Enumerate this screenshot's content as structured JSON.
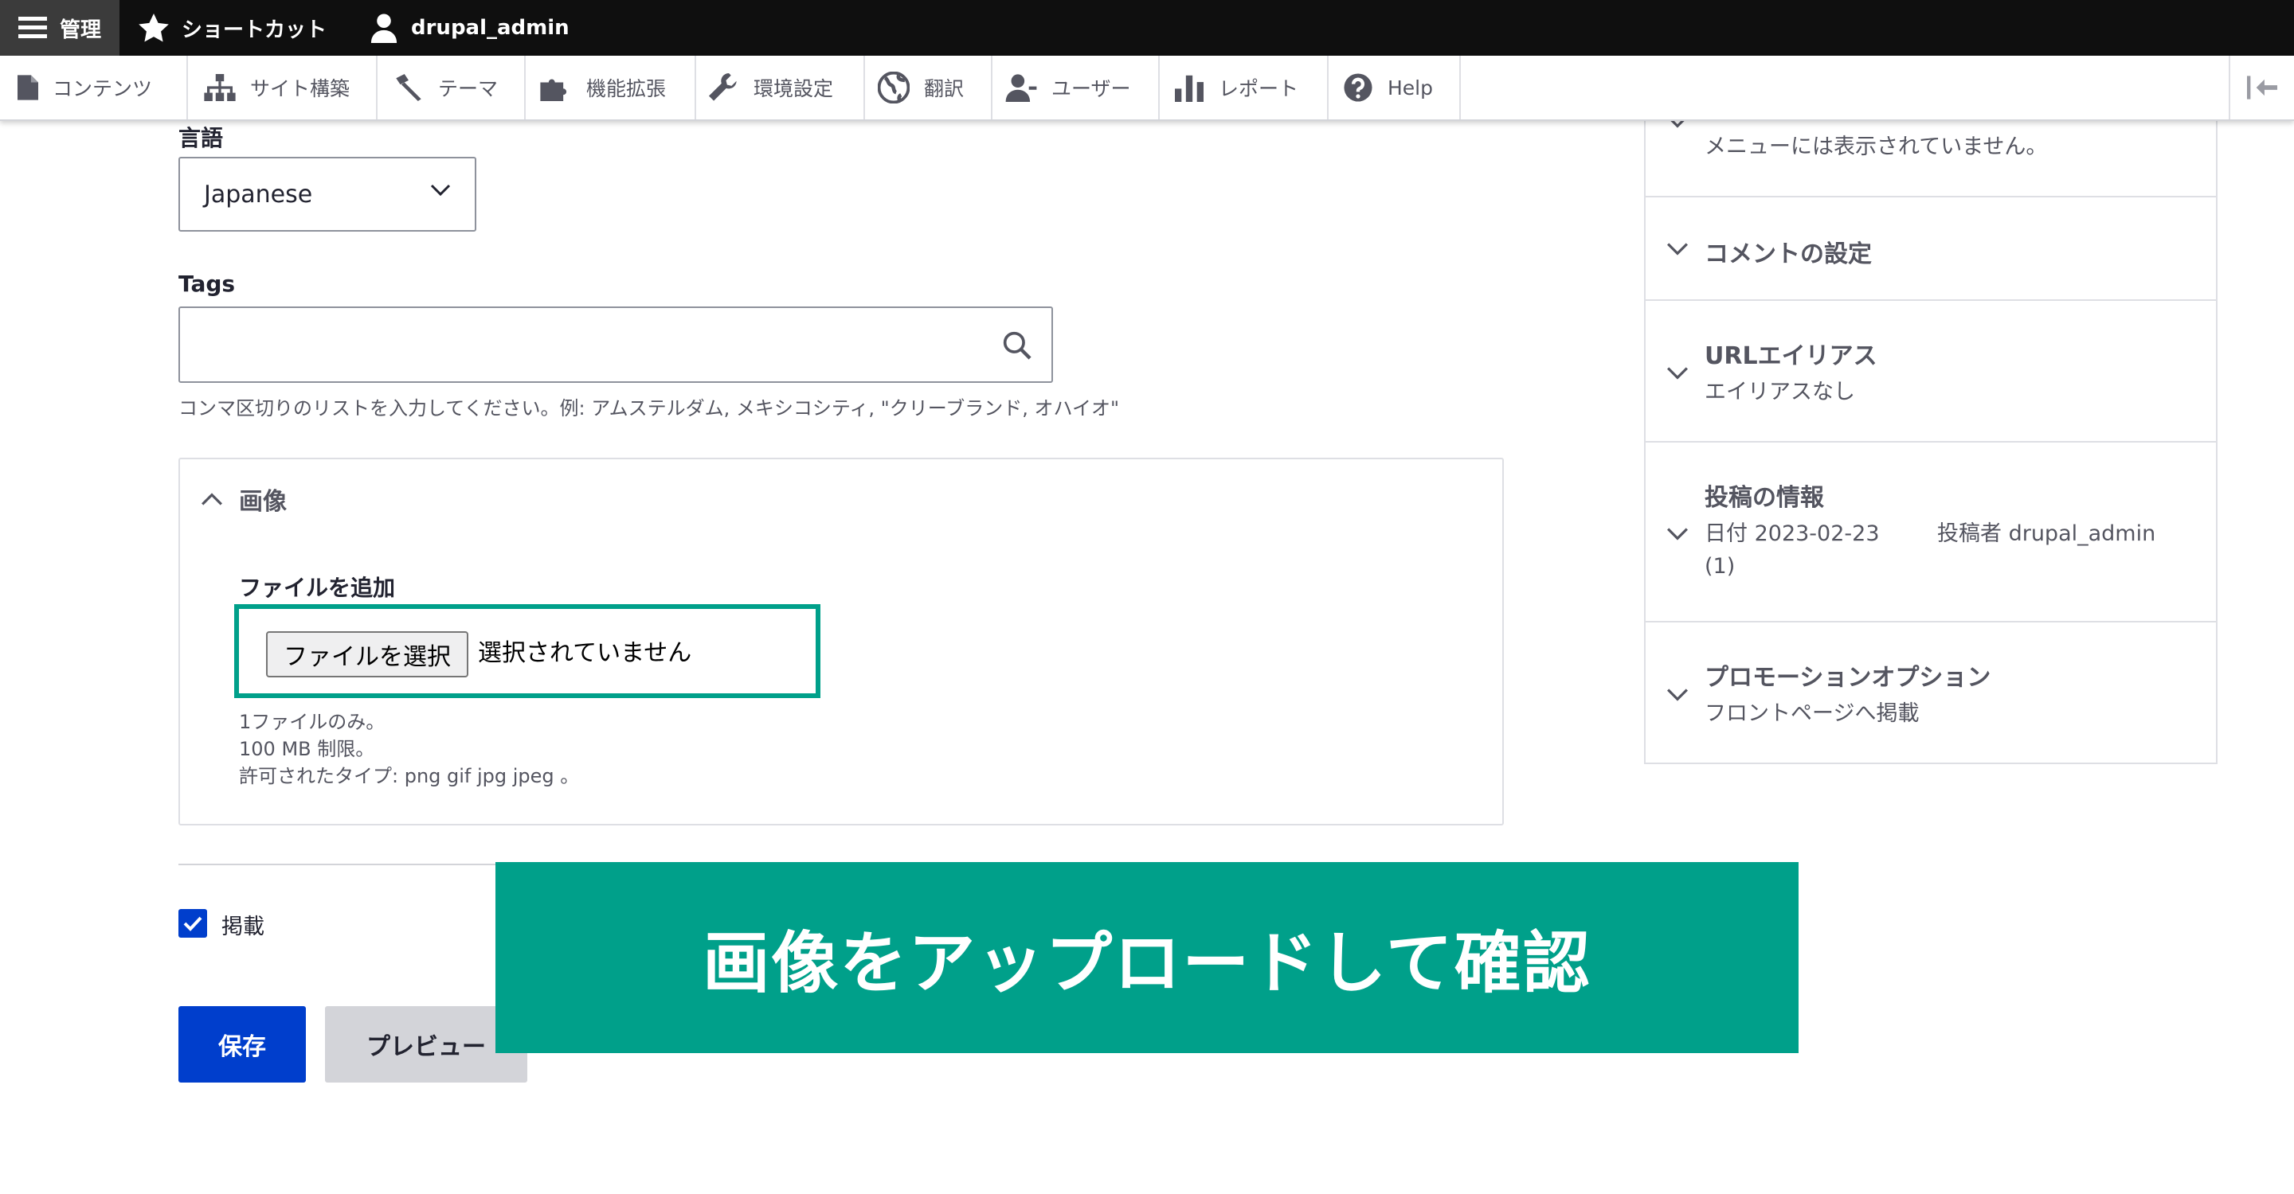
{
  "toolbar": {
    "manage": "管理",
    "shortcuts": "ショートカット",
    "user": "drupal_admin"
  },
  "tray": {
    "items": [
      "コンテンツ",
      "サイト構築",
      "テーマ",
      "機能拡張",
      "環境設定",
      "翻訳",
      "ユーザー",
      "レポート",
      "Help"
    ]
  },
  "form": {
    "language_label": "言語",
    "language_value": "Japanese",
    "tags_label": "Tags",
    "tags_value": "",
    "tags_desc": "コンマ区切りのリストを入力してください。例: アムステルダム, メキシコシティ, \"クリーブランド, オハイオ\"",
    "image_title": "画像",
    "file_add_label": "ファイルを追加",
    "file_button": "ファイルを選択",
    "file_status": "選択されていません",
    "file_desc": [
      "1ファイルのみ。",
      "100 MB 制限。",
      "許可されたタイプ: png gif jpg jpeg 。"
    ],
    "published_label": "掲載",
    "published": true,
    "save": "保存",
    "preview": "プレビュー"
  },
  "sidebar": {
    "menu_summary": "メニューには表示されていません。",
    "comment_title": "コメントの設定",
    "url_title": "URLエイリアス",
    "url_summary": "エイリアスなし",
    "authoring_title": "投稿の情報",
    "authoring_summary_1": "日付 2023-02-23",
    "authoring_summary_2": "投稿者 drupal_admin",
    "authoring_summary_3": "(1)",
    "promotion_title": "プロモーションオプション",
    "promotion_summary": "フロントページへ掲載"
  },
  "banner": {
    "text": "画像をアップロードして確認"
  },
  "colors": {
    "accent_green": "#00a08a",
    "primary_blue": "#003ecc",
    "toolbar_black": "#0f0f0f"
  }
}
